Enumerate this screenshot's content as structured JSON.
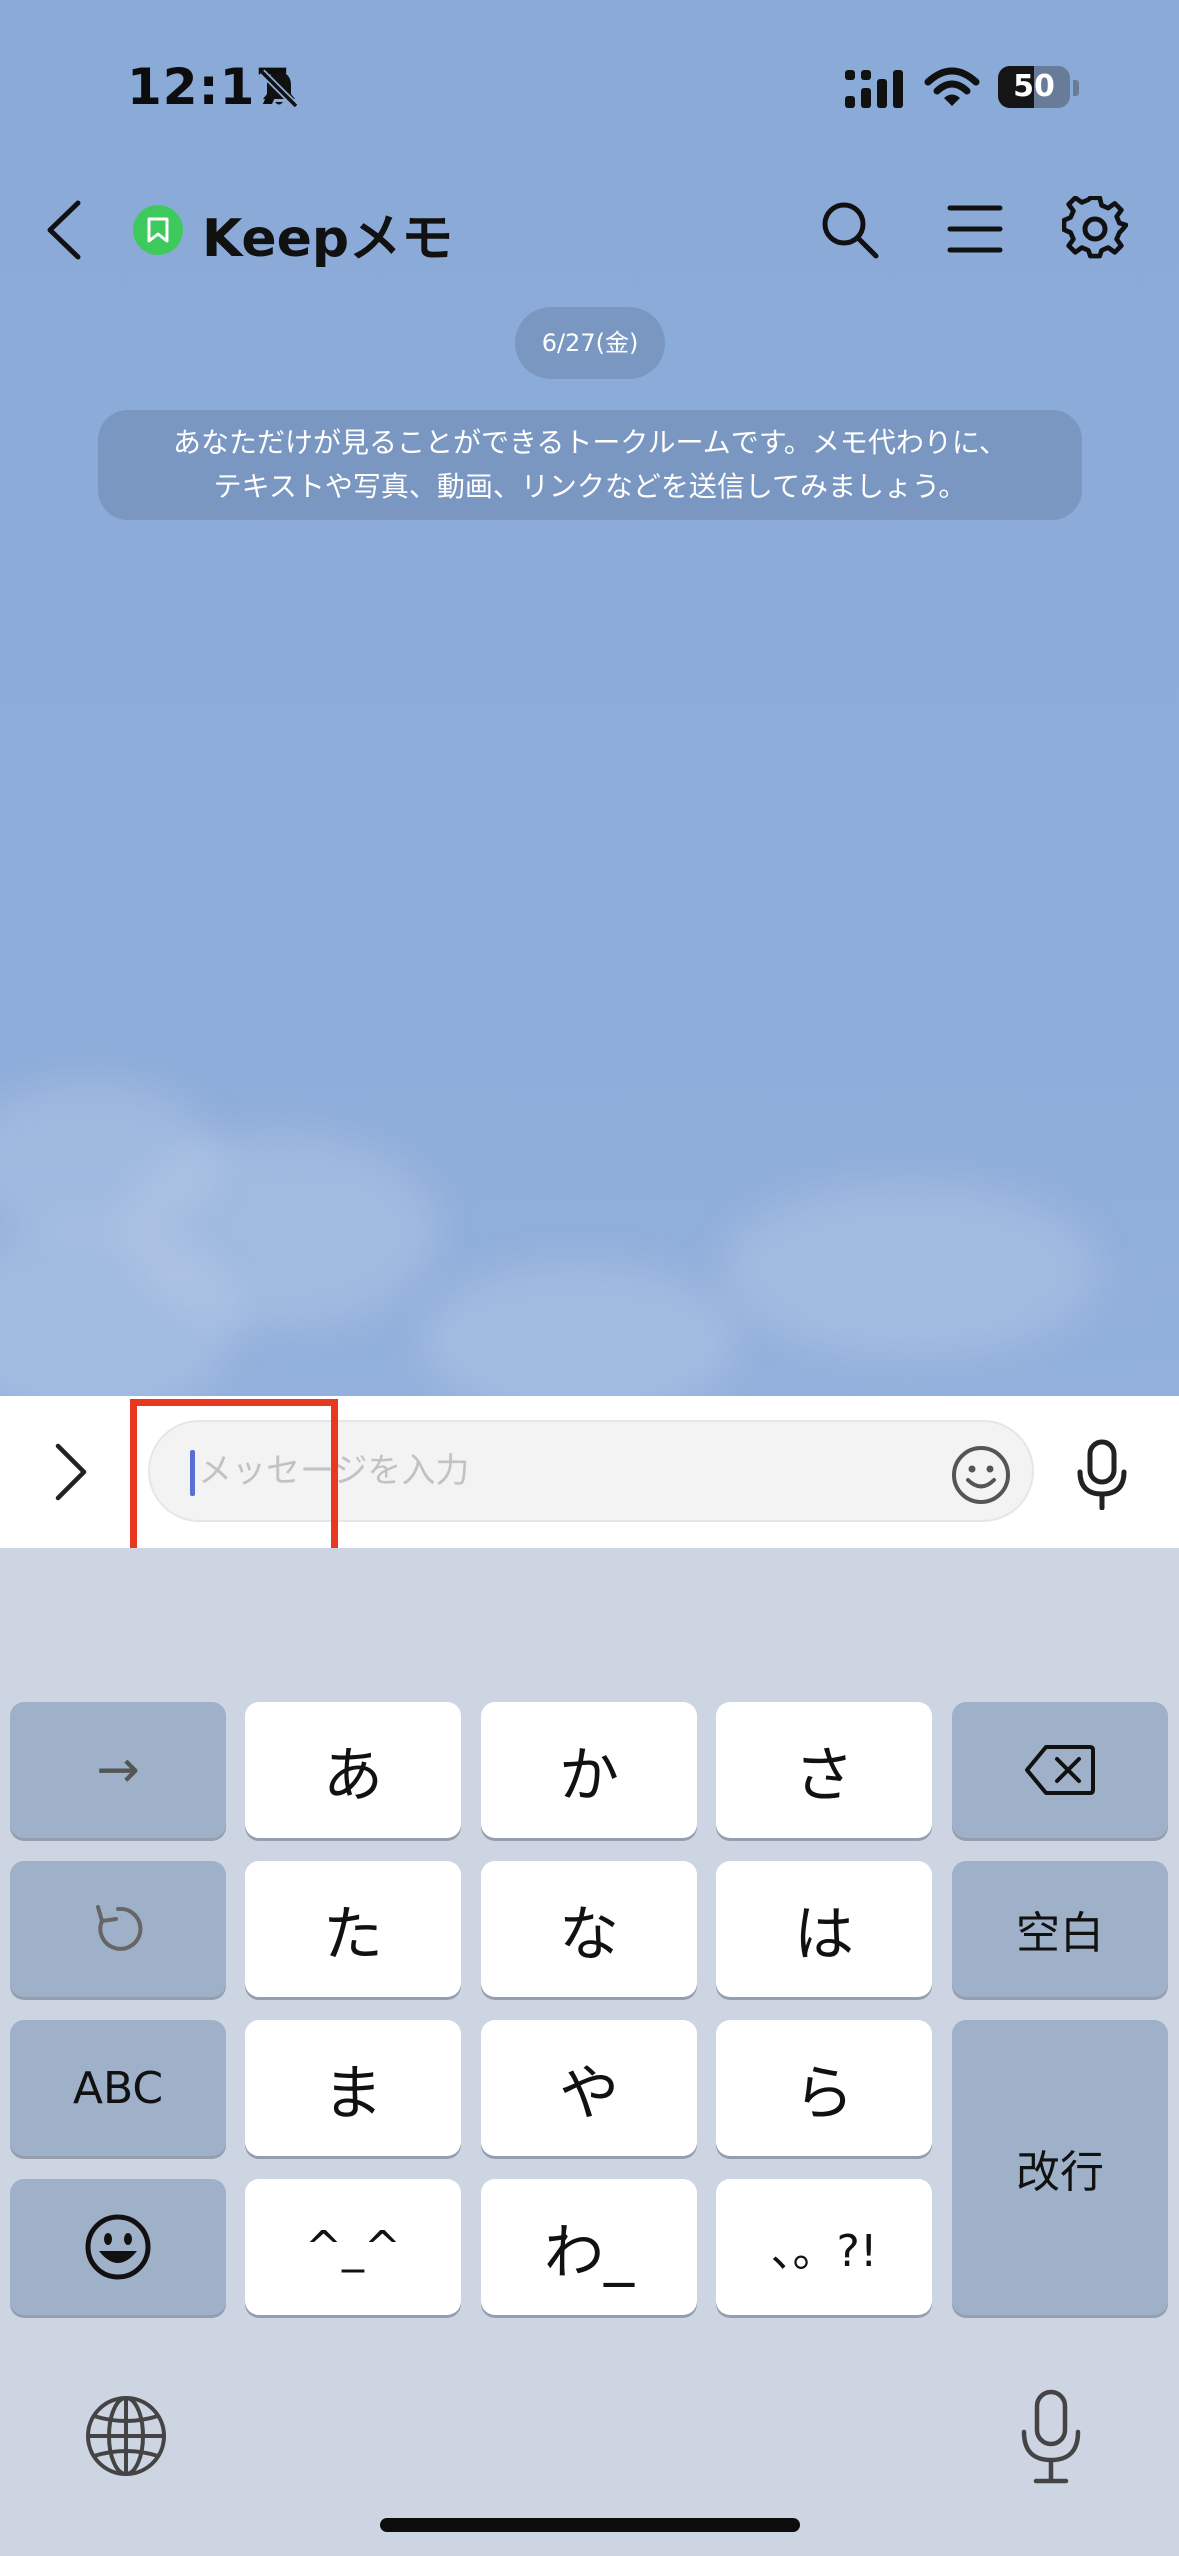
{
  "status_bar": {
    "time": "12:17",
    "battery_level": "50"
  },
  "header": {
    "title": "Keepメモ"
  },
  "chat": {
    "date": "6/27(金)",
    "system_message_line1": "あなただけが見ることができるトークルームです。メモ代わりに、",
    "system_message_line2": "テキストや写真、動画、リンクなどを送信してみましょう。"
  },
  "input": {
    "placeholder": "メッセージを入力",
    "value": ""
  },
  "keyboard": {
    "keys": {
      "next": "→",
      "a": "あ",
      "ka": "か",
      "sa": "さ",
      "ta": "た",
      "na": "な",
      "ha": "は",
      "ma": "ま",
      "ya": "や",
      "ra": "ら",
      "face": "^_^",
      "wa": "わ_",
      "punct": "、。?!",
      "space": "空白",
      "abc": "ABC",
      "enter": "改行"
    }
  },
  "colors": {
    "chat_background": "#8aabd9",
    "keep_badge": "#3ec95c",
    "highlight": "#e8391f",
    "keyboard_background": "#cdd5e3"
  }
}
